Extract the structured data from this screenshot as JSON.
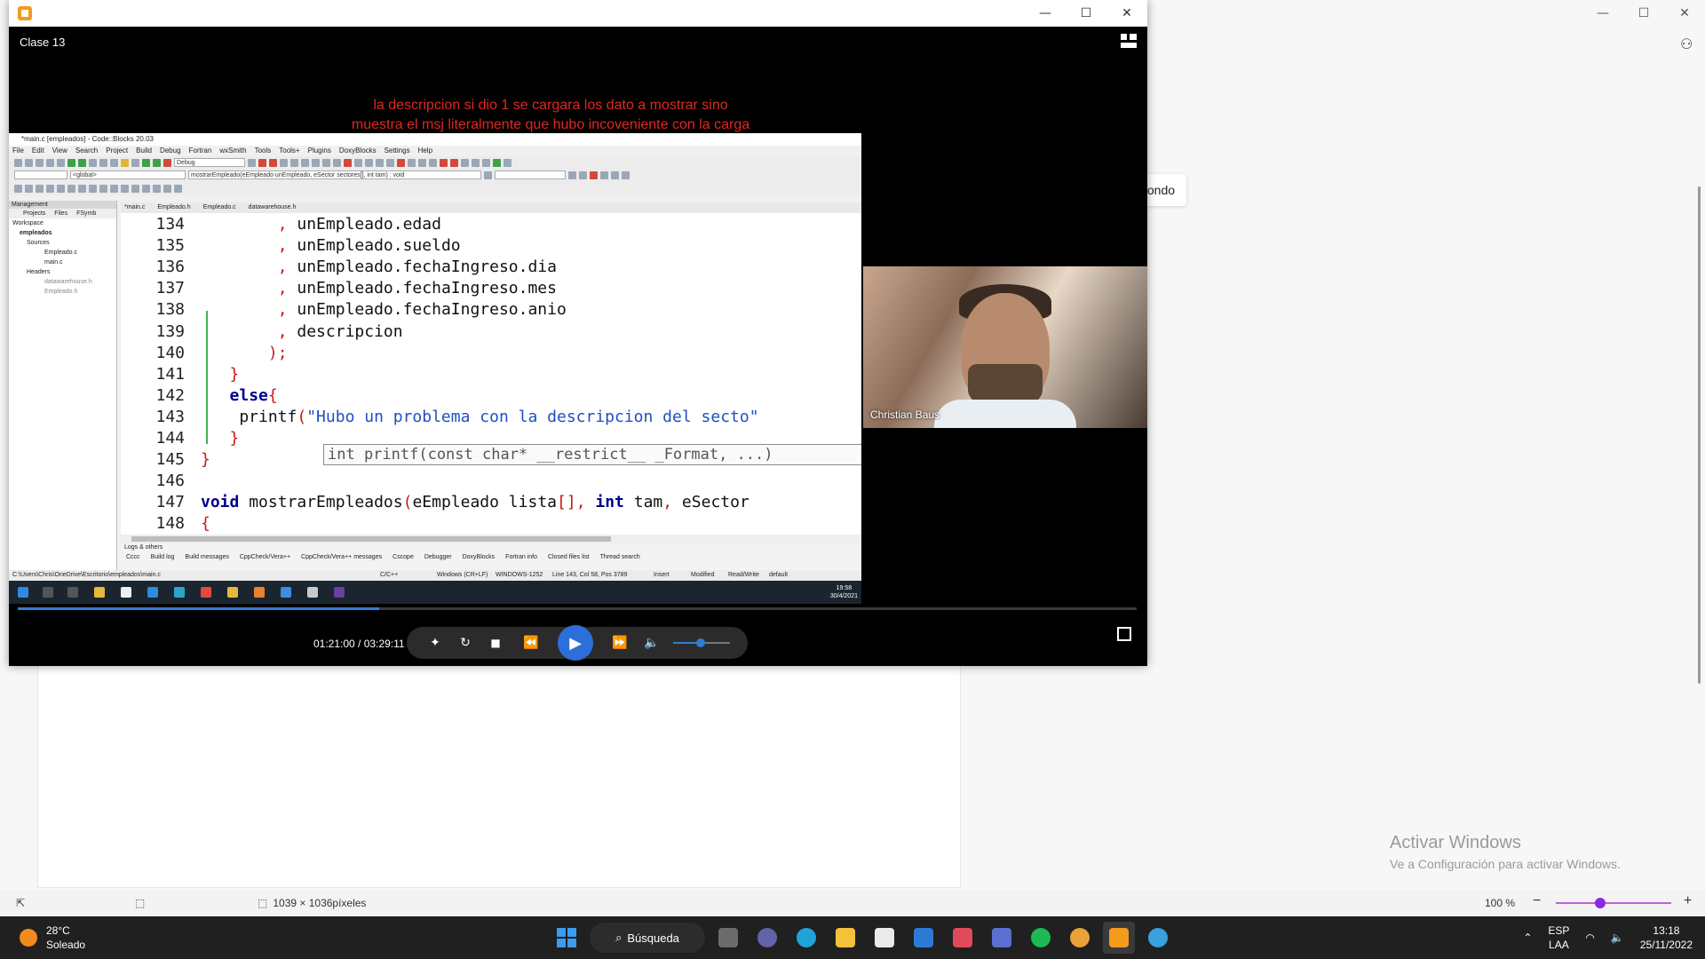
{
  "background_app": {
    "popup_text": "fondo",
    "activate_title": "Activar Windows",
    "activate_subtitle": "Ve a Configuración para activar Windows.",
    "status": {
      "dimensions": "1039 × 1036píxeles",
      "zoom": "100 %",
      "zoom_minus": "−",
      "zoom_plus": "+"
    },
    "controls": {
      "minimize": "—",
      "maximize": "☐",
      "close": "✕"
    }
  },
  "player": {
    "title": "Clase 13",
    "controls": {
      "minimize": "—",
      "maximize": "☐",
      "close": "✕"
    },
    "annotation": "la descripcion si dio 1 se cargara los dato a mostrar sino muestra el msj literalmente que hubo incoveniente con la carga descripcion",
    "webcam_name": "Christian Baus",
    "time": "01:21:00 / 03:29:11",
    "progress_fraction": 0.323,
    "volume_fraction": 0.45,
    "buttons": {
      "rewind": "⏪",
      "forward": "⏩",
      "stop": "■",
      "loop": "↻",
      "play": "▶",
      "volume": "🔈",
      "subtitles": "✦"
    }
  },
  "codeblocks": {
    "window_title": "*main.c [empleados] - Code::Blocks 20.03",
    "menu": [
      "File",
      "Edit",
      "View",
      "Search",
      "Project",
      "Build",
      "Debug",
      "Fortran",
      "wxSmith",
      "Tools",
      "Tools+",
      "Plugins",
      "DoxyBlocks",
      "Settings",
      "Help"
    ],
    "build_target": "Debug",
    "scope": "<global>",
    "function_combo": "mostrarEmpleado(eEmpleado unEmpleado, eSector sectores[], int tam) : void",
    "management_title": "Management",
    "left_tabs": [
      "Projects",
      "Files",
      "FSymb"
    ],
    "tree": [
      "Workspace",
      "empleados",
      "Sources",
      "Empleado.c",
      "main.c",
      "Headers",
      "datawarehouse.h",
      "Empleado.h"
    ],
    "file_tabs": [
      "*main.c",
      "Empleado.h",
      "Empleado.c",
      "datawarehouse.h"
    ],
    "lines": [
      {
        "n": "134",
        "code": "        , unEmpleado.edad"
      },
      {
        "n": "135",
        "code": "        , unEmpleado.sueldo"
      },
      {
        "n": "136",
        "code": "        , unEmpleado.fechaIngreso.dia"
      },
      {
        "n": "137",
        "code": "        , unEmpleado.fechaIngreso.mes"
      },
      {
        "n": "138",
        "code": "        , unEmpleado.fechaIngreso.anio"
      },
      {
        "n": "139",
        "code": "        , descripcion"
      },
      {
        "n": "140",
        "code": "       );"
      },
      {
        "n": "141",
        "code": "   }"
      },
      {
        "n": "142",
        "code": "   else{"
      },
      {
        "n": "143",
        "code": "    printf(\"Hubo un problema con la descripcion del secto\""
      },
      {
        "n": "144",
        "code": "   }"
      },
      {
        "n": "145",
        "code": "}"
      },
      {
        "n": "146",
        "code": ""
      },
      {
        "n": "147",
        "code": "void mostrarEmpleados(eEmpleado lista[], int tam, eSector"
      },
      {
        "n": "148",
        "code": "{"
      }
    ],
    "tooltip": "int printf(const char* __restrict__ _Format, ...)",
    "logs_title": "Logs & others",
    "log_tabs": [
      "Cccc",
      "Build log",
      "Build messages",
      "CppCheck/Vera++",
      "CppCheck/Vera++ messages",
      "Cscope",
      "Debugger",
      "DoxyBlocks",
      "Fortran info",
      "Closed files list",
      "Thread search"
    ],
    "status": {
      "path": "C:\\Users\\Chris\\OneDrive\\Escritorio\\empleados\\main.c",
      "lang": "C/C++",
      "eol": "Windows (CR+LF)",
      "encoding": "WINDOWS-1252",
      "position": "Line 143, Col 58, Pos 3789",
      "mode": "Insert",
      "modified": "Modified",
      "access": "Read/Write",
      "profile": "default"
    },
    "inner_clock_time": "19:58",
    "inner_clock_date": "30/4/2021"
  },
  "taskbar": {
    "temp": "28°C",
    "weather": "Soleado",
    "search_label": "Búsqueda",
    "lang_1": "ESP",
    "lang_2": "LAA",
    "time": "13:18",
    "date": "25/11/2022",
    "apps": [
      "task-view",
      "teams",
      "edge",
      "file-explorer",
      "store",
      "mail",
      "snipping",
      "app-blue",
      "spotify",
      "chrome",
      "media-player",
      "paint"
    ]
  }
}
